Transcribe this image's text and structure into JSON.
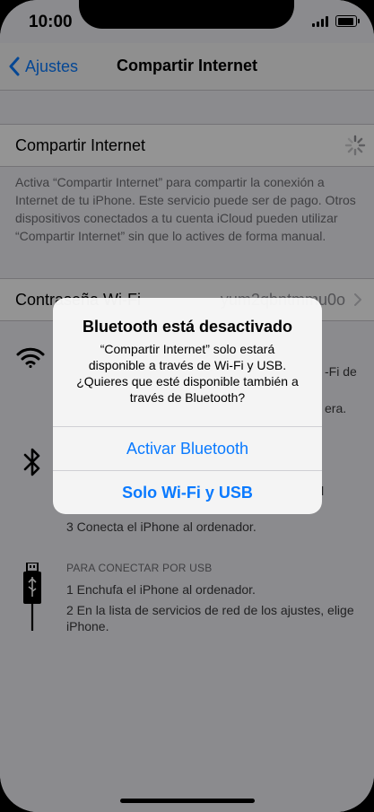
{
  "status_bar": {
    "time": "10:00"
  },
  "nav": {
    "back_label": "Ajustes",
    "title": "Compartir Internet"
  },
  "hotspot": {
    "label": "Compartir Internet",
    "footer": "Activa “Compartir Internet” para compartir la conexión a Internet de tu iPhone. Este servicio puede ser de pago. Otros dispositivos conectados a tu cuenta iCloud pueden utilizar “Compartir Internet” sin que lo actives de forma manual."
  },
  "wifi_password": {
    "label": "Contraseña Wi-Fi",
    "value": "yum2qbntmmu0o"
  },
  "instructions": {
    "wifi_partial_1": "-Fi de",
    "wifi_partial_2": "era.",
    "bt_partial_1": "l",
    "bt_step_3": "3 Conecta el iPhone al ordenador.",
    "usb_header": "PARA CONECTAR POR USB",
    "usb_step_1": "1 Enchufa el iPhone al ordenador.",
    "usb_step_2": "2 En la lista de servicios de red de los ajustes, elige iPhone."
  },
  "alert": {
    "title": "Bluetooth está desactivado",
    "message": "“Compartir Internet” solo estará disponible a través de Wi-Fi y USB. ¿Quieres que esté disponible también a través de Bluetooth?",
    "primary_label": "Activar Bluetooth",
    "secondary_label": "Solo Wi-Fi y USB"
  },
  "colors": {
    "accent": "#0a7aff",
    "background": "#efeff4",
    "overlay": "rgba(0,0,0,0.42)"
  },
  "icons": [
    "chevron-left-icon",
    "spinner-icon",
    "chevron-right-icon",
    "wifi-icon",
    "bluetooth-icon",
    "usb-cable-icon",
    "signal-icon",
    "battery-icon"
  ]
}
